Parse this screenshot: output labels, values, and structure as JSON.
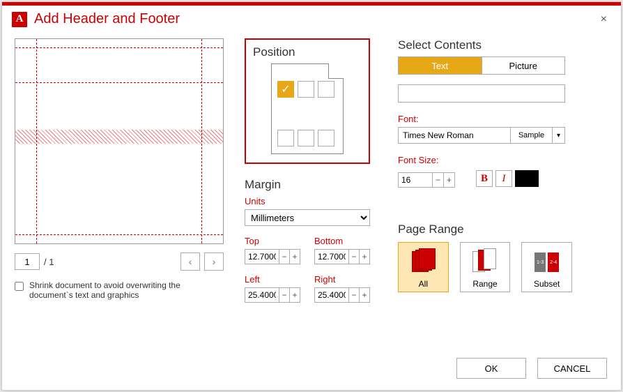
{
  "titlebar": {
    "icon_letter": "A",
    "title": "Add Header and Footer",
    "close": "×"
  },
  "preview": {
    "page_current": "1",
    "page_total": "/ 1",
    "prev": "‹",
    "next": "›",
    "shrink_label": "Shrink document to avoid overwriting the document`s text and graphics"
  },
  "position": {
    "title": "Position",
    "check": "✓"
  },
  "margin": {
    "title": "Margin",
    "units_label": "Units",
    "units_value": "Millimeters",
    "top_label": "Top",
    "top_value": "12.7000",
    "bottom_label": "Bottom",
    "bottom_value": "12.7000",
    "left_label": "Left",
    "left_value": "25.4000",
    "right_label": "Right",
    "right_value": "25.4000",
    "minus": "−",
    "plus": "+"
  },
  "contents": {
    "title": "Select Contents",
    "tab_text": "Text",
    "tab_picture": "Picture",
    "font_label": "Font:",
    "font_name": "Times New Roman",
    "sample": "Sample",
    "size_label": "Font Size:",
    "size_value": "16",
    "minus": "−",
    "plus": "+",
    "bold": "B",
    "italic": "I"
  },
  "pagerange": {
    "title": "Page Range",
    "all": "All",
    "range": "Range",
    "subset": "Subset",
    "s13": "1-3",
    "s24": "2-4"
  },
  "buttons": {
    "ok": "OK",
    "cancel": "CANCEL"
  }
}
